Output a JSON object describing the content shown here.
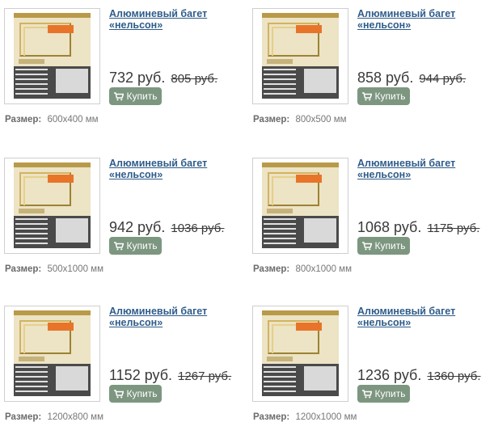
{
  "products": [
    {
      "title_line1": "Алюминевый багет",
      "title_line2": "«нельсон»",
      "price": "732 руб.",
      "old_price": "805 руб.",
      "buy_label": "Купить",
      "size_label": "Размер:",
      "size_value": "600x400 мм"
    },
    {
      "title_line1": "Алюминевый багет",
      "title_line2": "«нельсон»",
      "price": "858 руб.",
      "old_price": "944 руб.",
      "buy_label": "Купить",
      "size_label": "Размер:",
      "size_value": "800x500 мм"
    },
    {
      "title_line1": "Алюминевый багет",
      "title_line2": "«нельсон»",
      "price": "942 руб.",
      "old_price": "1036 руб.",
      "buy_label": "Купить",
      "size_label": "Размер:",
      "size_value": "500x1000 мм"
    },
    {
      "title_line1": "Алюминевый багет",
      "title_line2": "«нельсон»",
      "price": "1068 руб.",
      "old_price": "1175 руб.",
      "buy_label": "Купить",
      "size_label": "Размер:",
      "size_value": "800x1000 мм"
    },
    {
      "title_line1": "Алюминевый багет",
      "title_line2": "«нельсон»",
      "price": "1152 руб.",
      "old_price": "1267 руб.",
      "buy_label": "Купить",
      "size_label": "Размер:",
      "size_value": "1200x800 мм"
    },
    {
      "title_line1": "Алюминевый багет",
      "title_line2": "«нельсон»",
      "price": "1236 руб.",
      "old_price": "1360 руб.",
      "buy_label": "Купить",
      "size_label": "Размер:",
      "size_value": "1200x1000 мм"
    }
  ],
  "colors": {
    "link": "#2f5c8a",
    "buy_button": "#7d9680",
    "price": "#3a3a3a"
  },
  "icons": {
    "buy": "shopping-cart-icon"
  }
}
